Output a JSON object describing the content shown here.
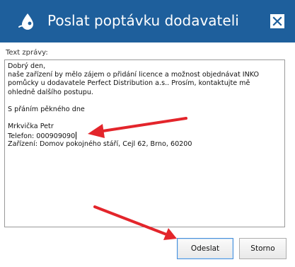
{
  "titlebar": {
    "title": "Poslat poptávku dodavateli",
    "icon": "drop-icon",
    "close_icon": "close-icon",
    "bg_color": "#1e5f9c"
  },
  "message": {
    "label": "Text zprávy:",
    "lines": [
      "Dobrý den,",
      "naše zařízení by mělo zájem o přidání licence a možnost objednávat INKO",
      "pomůcky u dodavatele Perfect Distribution a.s.. Prosím, kontaktujte mě",
      "ohledně dalšího postupu.",
      "",
      "S přáním pěkného dne",
      "",
      "Mrkvička Petr",
      "Telefon: 000909090",
      "Zařízení: Domov pokojného stáří, Cejl 62, Brno, 60200"
    ]
  },
  "buttons": {
    "send": "Odeslat",
    "cancel": "Storno"
  },
  "annotation": {
    "arrow_color": "#e3252b"
  }
}
